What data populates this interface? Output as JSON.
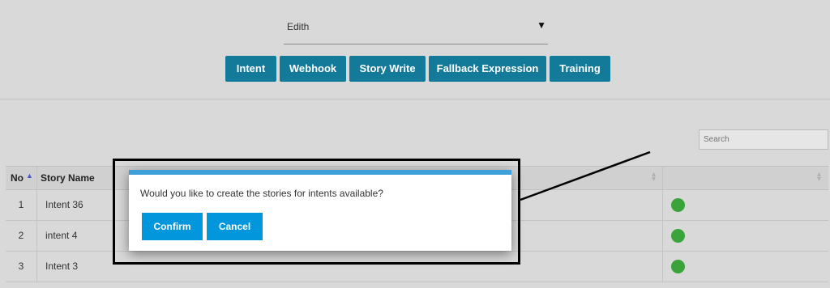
{
  "selector": {
    "value": "Edith",
    "caret": "▼"
  },
  "tabs": [
    {
      "label": "Intent"
    },
    {
      "label": "Webhook"
    },
    {
      "label": "Story Write"
    },
    {
      "label": "Fallback Expression"
    },
    {
      "label": "Training"
    }
  ],
  "search": {
    "placeholder": "Search"
  },
  "table": {
    "headers": {
      "no": "No",
      "name": "Story Name"
    },
    "sort_icons": {
      "asc": "▲",
      "both": "▲▼"
    },
    "rows": [
      {
        "no": "1",
        "name": "Intent 36",
        "status_color": "#3aa33a"
      },
      {
        "no": "2",
        "name": "intent 4",
        "status_color": "#3aa33a"
      },
      {
        "no": "3",
        "name": "Intent 3",
        "status_color": "#3aa33a"
      }
    ]
  },
  "modal": {
    "message": "Would you like to create the stories for intents available?",
    "confirm_label": "Confirm",
    "cancel_label": "Cancel"
  },
  "colors": {
    "tab_bg": "#137a99",
    "modal_button_bg": "#0296dc",
    "modal_top_bar": "#3f9fd9",
    "status_ok": "#3aa33a"
  }
}
